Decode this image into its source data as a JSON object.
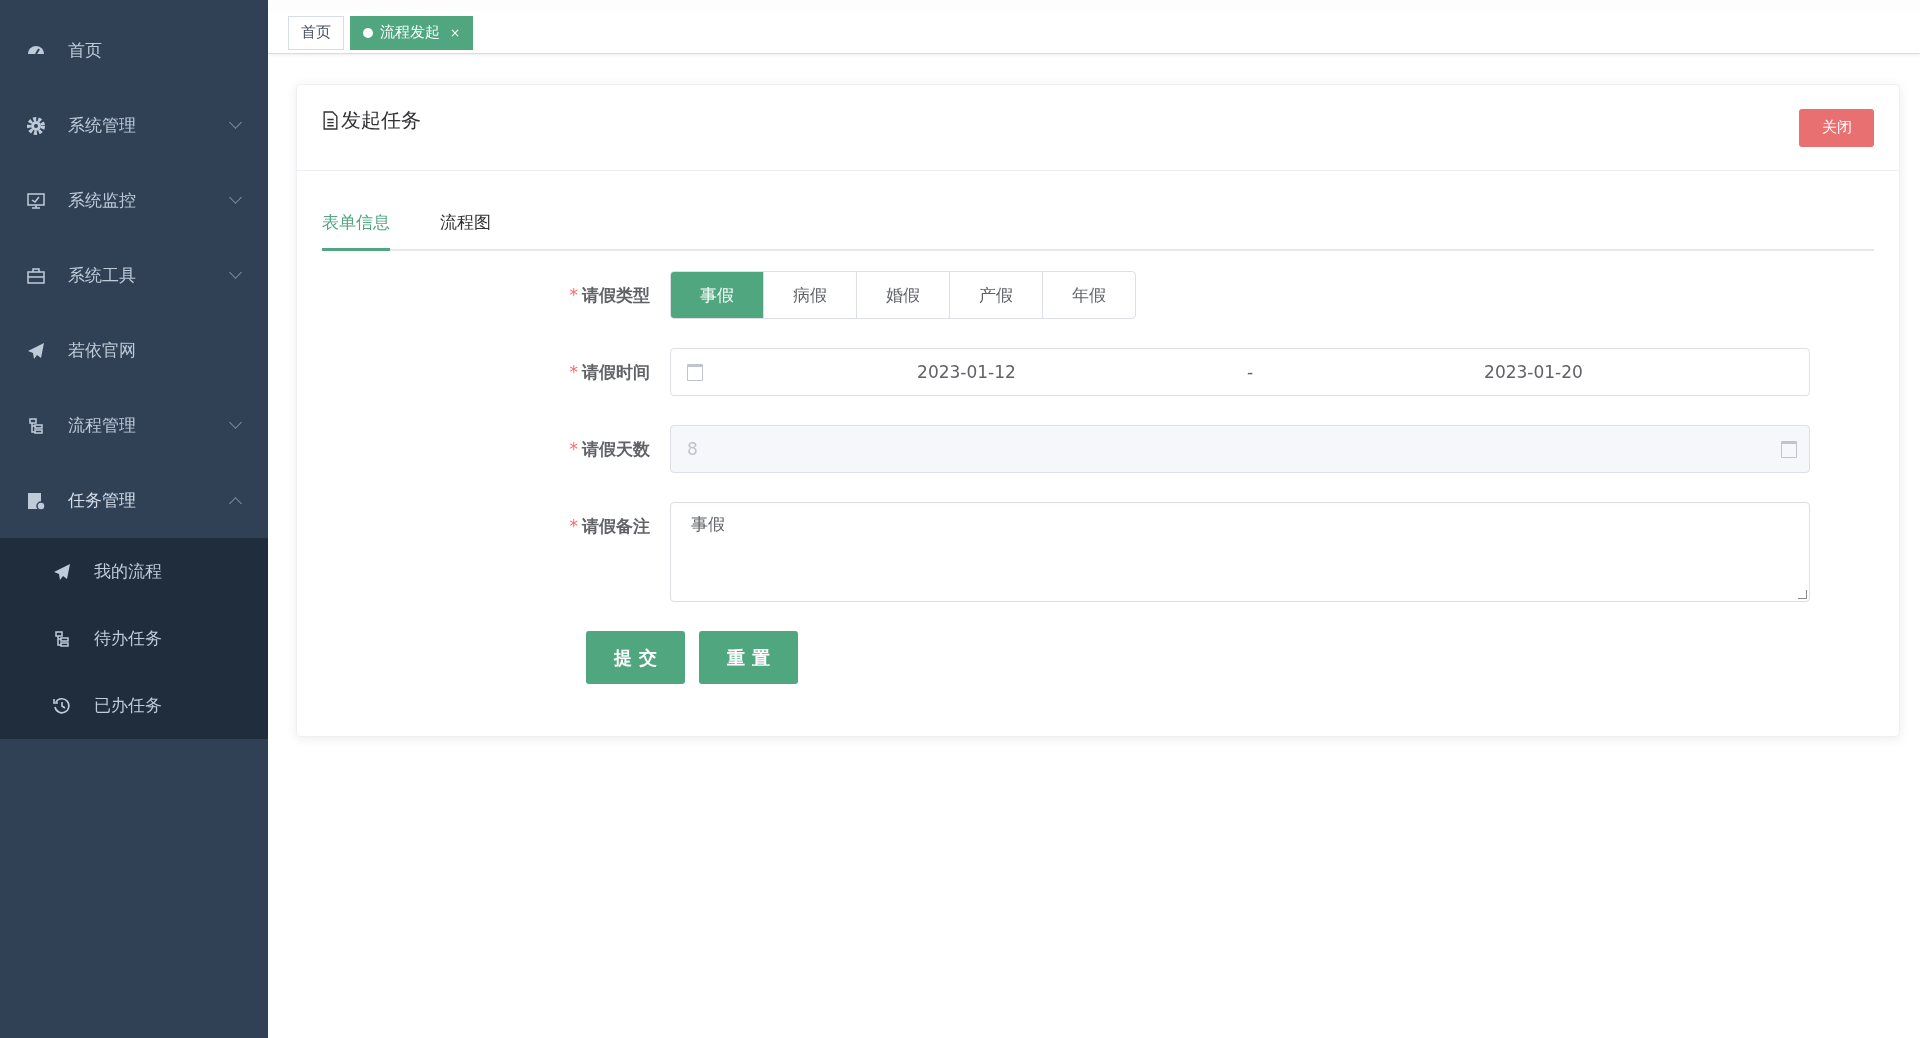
{
  "sidebar": {
    "items": [
      {
        "label": "首页"
      },
      {
        "label": "系统管理",
        "expanded": false
      },
      {
        "label": "系统监控",
        "expanded": false
      },
      {
        "label": "系统工具",
        "expanded": false
      },
      {
        "label": "若依官网"
      },
      {
        "label": "流程管理",
        "expanded": false
      },
      {
        "label": "任务管理",
        "expanded": true,
        "children": [
          {
            "label": "我的流程"
          },
          {
            "label": "待办任务"
          },
          {
            "label": "已办任务"
          }
        ]
      }
    ]
  },
  "tags_view": [
    {
      "label": "首页",
      "selected": false
    },
    {
      "label": "流程发起",
      "selected": true,
      "close": "×"
    }
  ],
  "card": {
    "title": "发起任务",
    "close_button": "关闭",
    "tabs": [
      {
        "label": "表单信息",
        "selected": true
      },
      {
        "label": "流程图",
        "selected": false
      }
    ],
    "form": [
      {
        "kind": "radio",
        "label": "请假类型",
        "required_mark": "*",
        "options": [
          {
            "label": "事假",
            "selected": true
          },
          {
            "label": "病假",
            "selected": false
          },
          {
            "label": "婚假",
            "selected": false
          },
          {
            "label": "产假",
            "selected": false
          },
          {
            "label": "年假",
            "selected": false
          }
        ]
      },
      {
        "kind": "daterange",
        "label": "请假时间",
        "required_mark": "*",
        "start": "2023-01-12",
        "separator": "-",
        "end": "2023-01-20"
      },
      {
        "kind": "input",
        "label": "请假天数",
        "required_mark": "*",
        "value": "8",
        "disabled": true
      },
      {
        "kind": "textarea",
        "label": "请假备注",
        "required_mark": "*",
        "value": "事假"
      }
    ],
    "buttons": [
      "提 交",
      "重 置"
    ]
  }
}
